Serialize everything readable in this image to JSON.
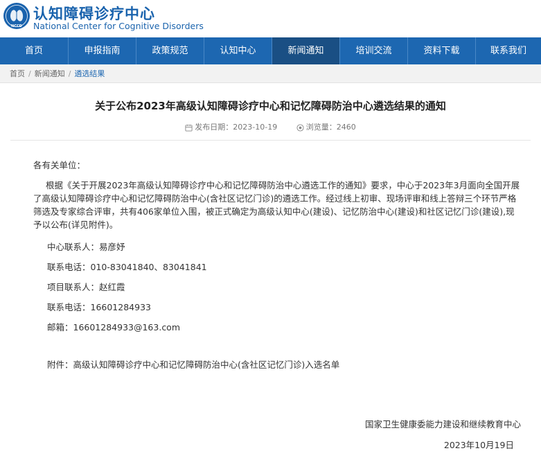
{
  "header": {
    "brand_cn": "认知障碍诊疗中心",
    "brand_en": "National Center for Cognitive Disorders",
    "logo_text": "NCCD",
    "brand_color": "#1a63ad"
  },
  "nav": {
    "items": [
      "首页",
      "申报指南",
      "政策规范",
      "认知中心",
      "新闻通知",
      "培训交流",
      "资料下载",
      "联系我们"
    ],
    "active_index": 4,
    "bg_color": "#1d67b1",
    "active_color": "#1a4f84"
  },
  "breadcrumb": {
    "items": [
      "首页",
      "新闻通知",
      "遴选结果"
    ],
    "separator": "/"
  },
  "article": {
    "title": "关于公布2023年高级认知障碍诊疗中心和记忆障碍防治中心遴选结果的通知",
    "publish_label": "发布日期：",
    "publish_date": "2023-10-19",
    "views_label": "浏览量：",
    "views": "2460",
    "greeting": "各有关单位：",
    "body_lines": [
      "根据《关于开展2023年高级认知障碍诊疗中心和记忆障碍防治中心遴选工作的通知》要求，中心于2023年3月面向全国开展",
      "了高级认知障碍诊疗中心和记忆障碍防治中心(含社区记忆门诊)的遴选工作。经过线上初审、现场评审和线上答辩三个环节严格",
      "筛选及专家综合评审，共有406家单位入围，被正式确定为高级认知中心(建设)、记忆防治中心(建设)和社区记忆门诊(建设),现",
      "予以公布(详见附件)。"
    ],
    "contacts": [
      "中心联系人：易彦妤",
      "联系电话：010-83041840、83041841",
      "项目联系人：赵红霞",
      "联系电话：16601284933",
      "邮箱：16601284933@163.com"
    ],
    "attachment": "附件：高级认知障碍诊疗中心和记忆障碍防治中心(含社区记忆门诊)入选名单",
    "signature_org": "国家卫生健康委能力建设和继续教育中心",
    "signature_date": "2023年10月19日"
  }
}
